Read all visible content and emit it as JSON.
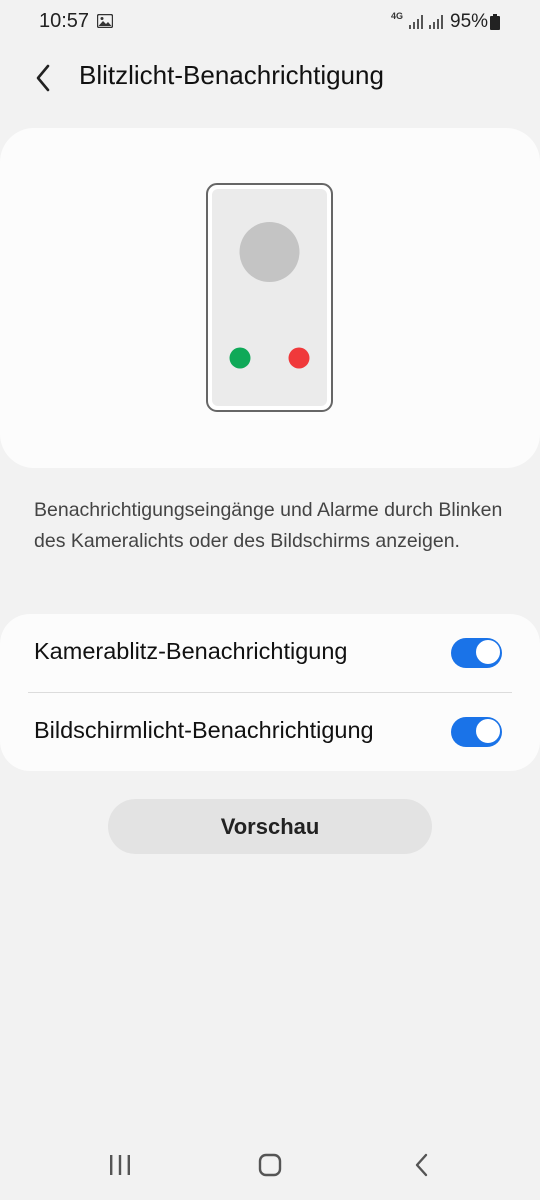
{
  "status_bar": {
    "time": "10:57",
    "network_type": "4G",
    "battery_percent": "95%",
    "icons": [
      "gallery-icon",
      "signal-icon",
      "signal-icon",
      "battery-icon"
    ]
  },
  "header": {
    "back_icon": "back-chevron-icon",
    "title": "Blitzlicht-Benachrichtigung"
  },
  "illustration": {
    "description": "phone-illustration",
    "colors": {
      "green_dot": "#0fa958",
      "red_dot": "#f0393b"
    }
  },
  "description": "Benachrichtigungseingänge und Alarme durch Blinken des Kameralichts oder des Bildschirms anzeigen.",
  "settings": [
    {
      "label": "Kamerablitz-Benachrichtigung",
      "enabled": true
    },
    {
      "label": "Bildschirmlicht-Benachrichtigung",
      "enabled": true
    }
  ],
  "preview_button": {
    "label": "Vorschau"
  },
  "nav_bar": {
    "icons": [
      "recent-apps-icon",
      "home-icon",
      "back-icon"
    ]
  },
  "colors": {
    "accent": "#1a73e8",
    "background": "#f2f2f2",
    "card": "#fcfcfc"
  }
}
